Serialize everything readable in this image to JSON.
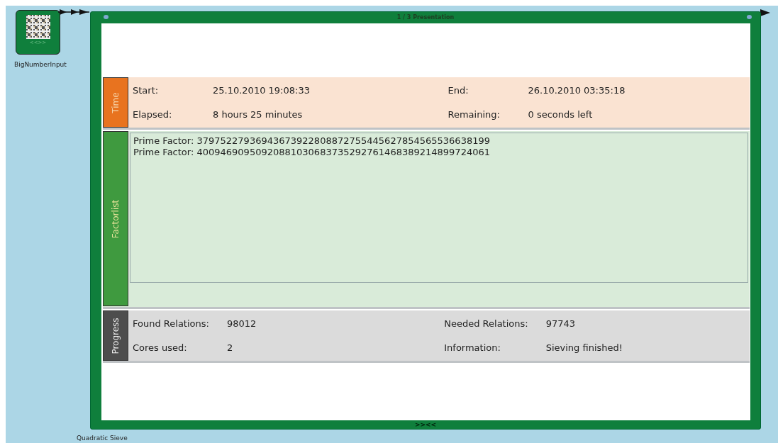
{
  "input_node": {
    "label": "BigNumberInput",
    "toggle": "<<>>"
  },
  "sieve_node": {
    "title": "1 / 3 Presentation",
    "label": "Quadratic Sieve",
    "toggle": ">><<",
    "sections": [
      {
        "kind": "fields",
        "title": "Time",
        "color": "#e8731f",
        "fields": [
          {
            "label": "Start:",
            "value": "25.10.2010 19:08:33"
          },
          {
            "label": "End:",
            "value": "26.10.2010 03:35:18"
          },
          {
            "label": "Elapsed:",
            "value": "8 hours 25 minutes"
          },
          {
            "label": "Remaining:",
            "value": "0 seconds left"
          }
        ]
      },
      {
        "kind": "list",
        "title": "Factorlist",
        "color": "#3f9a3f",
        "items": [
          "Prime Factor: 37975227936943673922808872755445627854565536638199",
          "Prime Factor: 40094690950920881030683735292761468389214899724061"
        ]
      },
      {
        "kind": "fields",
        "title": "Progress",
        "color": "#4d4d4d",
        "fields": [
          {
            "label": "Found Relations:",
            "value": "98012"
          },
          {
            "label": "Needed Relations:",
            "value": "97743"
          },
          {
            "label": "Cores used:",
            "value": "2"
          },
          {
            "label": "Information:",
            "value": "Sieving finished!"
          }
        ]
      }
    ]
  }
}
